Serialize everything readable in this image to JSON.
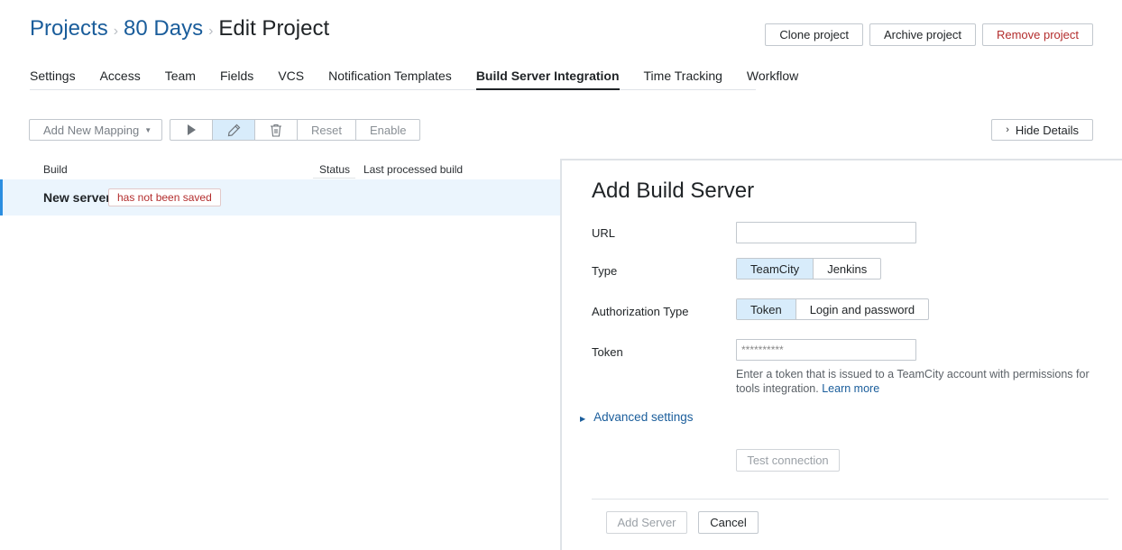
{
  "breadcrumb": {
    "projects": "Projects",
    "project": "80 Days",
    "current": "Edit Project",
    "separator": "›"
  },
  "header_actions": {
    "clone": "Clone project",
    "archive": "Archive project",
    "remove": "Remove project"
  },
  "tabs": [
    {
      "label": "Settings",
      "active": false
    },
    {
      "label": "Access",
      "active": false
    },
    {
      "label": "Team",
      "active": false
    },
    {
      "label": "Fields",
      "active": false
    },
    {
      "label": "VCS",
      "active": false
    },
    {
      "label": "Notification Templates",
      "active": false
    },
    {
      "label": "Build Server Integration",
      "active": true
    },
    {
      "label": "Time Tracking",
      "active": false
    },
    {
      "label": "Workflow",
      "active": false
    }
  ],
  "toolbar": {
    "add_mapping": "Add New Mapping",
    "reset": "Reset",
    "enable": "Enable",
    "hide_details": "Hide Details"
  },
  "list": {
    "columns": {
      "build": "Build",
      "status": "Status",
      "last_processed": "Last processed build"
    },
    "rows": [
      {
        "name": "New server",
        "badge": "has not been saved"
      }
    ]
  },
  "panel": {
    "title": "Add Build Server",
    "url_label": "URL",
    "url_value": "",
    "type_label": "Type",
    "type_options": [
      "TeamCity",
      "Jenkins"
    ],
    "auth_label": "Authorization Type",
    "auth_options": [
      "Token",
      "Login and password"
    ],
    "token_label": "Token",
    "token_value": "**********",
    "hint_text": "Enter a token that is issued to a TeamCity account with permissions for tools integration.",
    "hint_link": "Learn more",
    "advanced": "Advanced settings",
    "test_connection": "Test connection",
    "add_server": "Add Server",
    "cancel": "Cancel"
  },
  "colors": {
    "accent": "#1a5d9b",
    "selected": "#d8ecfb",
    "danger": "#b32d2d",
    "row_highlight": "#ebf5fd"
  },
  "icons": [
    "play-icon",
    "pencil-icon",
    "trash-icon",
    "chevron-right-icon",
    "caret-down-icon",
    "triangle-right-icon"
  ]
}
